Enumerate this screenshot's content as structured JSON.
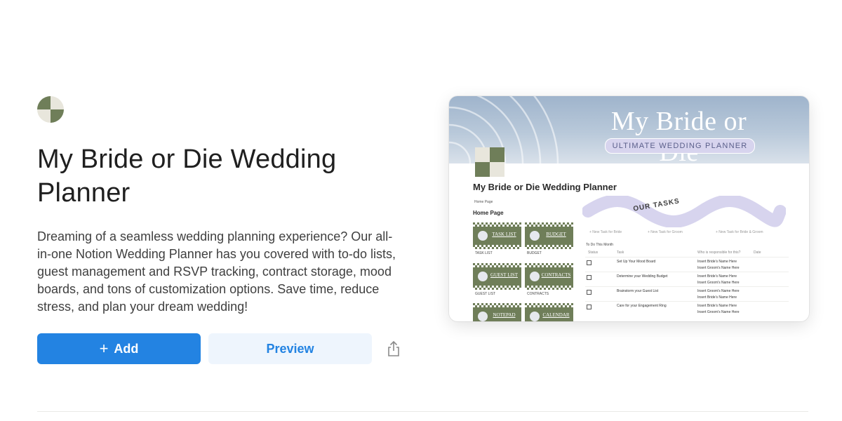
{
  "template": {
    "title": "My Bride or Die Wedding Planner",
    "description": "Dreaming of a seamless wedding planning experience? Our all-in-one Notion Wedding Planner has you covered with to-do lists, guest management and RSVP tracking, contract storage, mood boards, and tons of customization options. Save time, reduce stress, and plan your dream wedding!",
    "add_label": "Add",
    "preview_label": "Preview",
    "icons": {
      "add": "plus-icon",
      "share": "share-icon",
      "app": "checker-tile-icon"
    },
    "colors": {
      "primary": "#2383e2",
      "preview_bg": "#eef5fd",
      "sage": "#6f7e59"
    }
  },
  "preview": {
    "banner_title": "My Bride or Die",
    "banner_subtitle": "ULTIMATE WEDDING PLANNER",
    "page_title": "My Bride or Die Wedding Planner",
    "breadcrumb": "Home Page",
    "section_heading": "Home Page",
    "tiles": [
      {
        "label": "TASK LIST",
        "caption": "TASK LIST"
      },
      {
        "label": "BUDGET",
        "caption": "BUDGET"
      },
      {
        "label": "GUEST LIST",
        "caption": "GUEST LIST"
      },
      {
        "label": "CONTRACTS",
        "caption": "CONTRACTS"
      },
      {
        "label": "NOTEPAD",
        "caption": ""
      },
      {
        "label": "CALENDAR",
        "caption": ""
      }
    ],
    "tasks_banner": "OUR TASKS",
    "new_task_links": [
      "+ New Task for Bride",
      "+ New Task for Groom",
      "+ New Task for Bride & Groom"
    ],
    "todo_view": "To Do This Month",
    "columns": [
      "Status",
      "Task",
      "Who is responsible for this?",
      "Date"
    ],
    "rows": [
      {
        "task": "Set Up Your Mood Board",
        "who": [
          "Insert Bride's Name Here",
          "Insert Groom's Name Here"
        ]
      },
      {
        "task": "Determine your Wedding Budget",
        "who": [
          "Insert Bride's Name Here",
          "Insert Groom's Name Here"
        ]
      },
      {
        "task": "Brainstorm your Guest List",
        "who": [
          "Insert Groom's Name Here",
          "Insert Bride's Name Here"
        ]
      },
      {
        "task": "Care for your Engagement Ring",
        "who": [
          "Insert Bride's Name Here",
          "Insert Groom's Name Here"
        ]
      }
    ]
  }
}
